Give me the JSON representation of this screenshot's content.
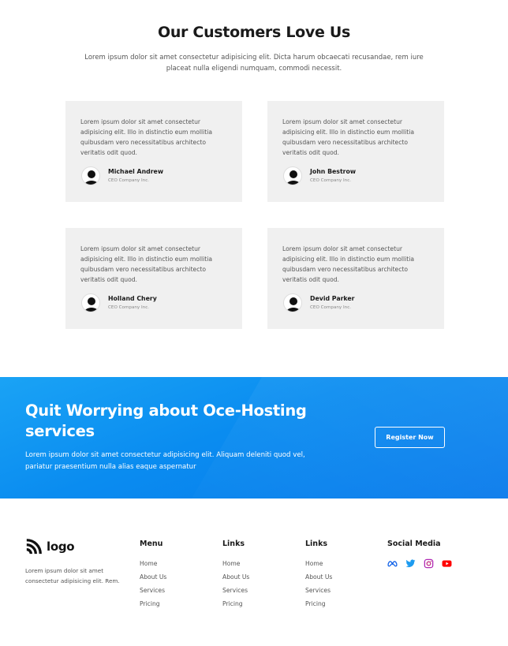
{
  "testimonials": {
    "title": "Our Customers Love Us",
    "subtitle": "Lorem ipsum dolor sit amet consectetur adipisicing elit. Dicta harum obcaecati recusandae, rem iure placeat nulla eligendi numquam, commodi necessit.",
    "cards": [
      {
        "text": "Lorem ipsum dolor sit amet consectetur adipisicing elit. Illo in distinctio eum mollitia quibusdam vero necessitatibus architecto veritatis odit quod.",
        "name": "Michael Andrew",
        "role": "CEO Company Inc."
      },
      {
        "text": "Lorem ipsum dolor sit amet consectetur adipisicing elit. Illo in distinctio eum mollitia quibusdam vero necessitatibus architecto veritatis odit quod.",
        "name": "John Bestrow",
        "role": "CEO Company Inc."
      },
      {
        "text": "Lorem ipsum dolor sit amet consectetur adipisicing elit. Illo in distinctio eum mollitia quibusdam vero necessitatibus architecto veritatis odit quod.",
        "name": "Holland Chery",
        "role": "CEO Company Inc."
      },
      {
        "text": "Lorem ipsum dolor sit amet consectetur adipisicing elit. Illo in distinctio eum mollitia quibusdam vero necessitatibus architecto veritatis odit quod.",
        "name": "Devid Parker",
        "role": "CEO Company Inc."
      }
    ]
  },
  "cta": {
    "title": "Quit Worrying about Oce-Hosting services",
    "text": "Lorem ipsum dolor sit amet consectetur adipisicing elit. Aliquam deleniti quod vel, pariatur praesentium nulla alias eaque aspernatur",
    "button_label": "Register Now",
    "colors": {
      "gradient_start": "#1aa3f5",
      "gradient_end": "#0779eb"
    }
  },
  "footer": {
    "logo_text": "logo",
    "logo_icon": "rss-icon",
    "description": "Lorem ipsum dolor sit amet consectetur adipisicing elit. Rem.",
    "columns": [
      {
        "heading": "Menu",
        "links": [
          "Home",
          "About Us",
          "Services",
          "Pricing"
        ]
      },
      {
        "heading": "Links",
        "links": [
          "Home",
          "About Us",
          "Services",
          "Pricing"
        ]
      },
      {
        "heading": "Links",
        "links": [
          "Home",
          "About Us",
          "Services",
          "Pricing"
        ]
      }
    ],
    "social": {
      "heading": "Social Media",
      "icons": [
        "meta-icon",
        "twitter-icon",
        "instagram-icon",
        "youtube-icon"
      ]
    }
  }
}
